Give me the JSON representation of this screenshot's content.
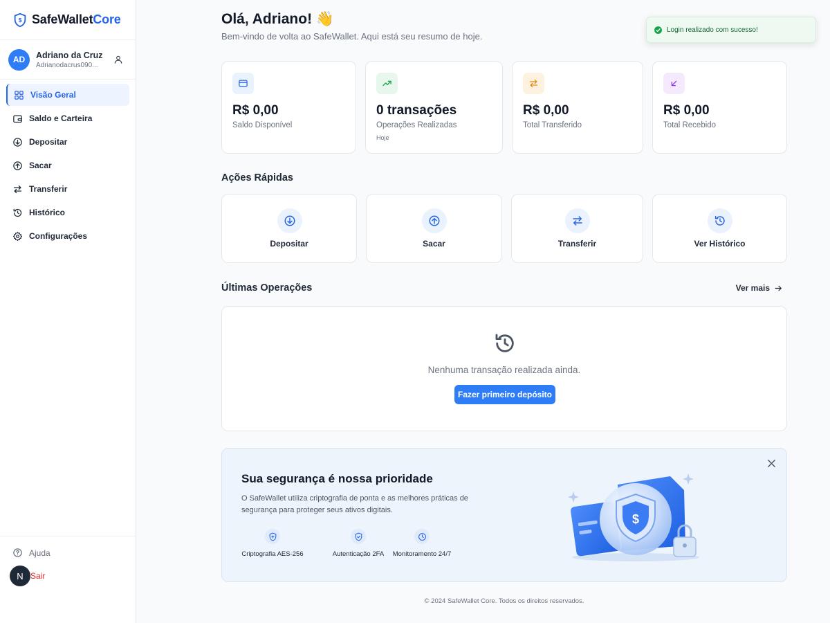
{
  "brand": {
    "name_part1": "SafeWallet",
    "name_part2": "Core"
  },
  "user": {
    "initials": "AD",
    "name": "Adriano da Cruz",
    "email": "Adrianodacrus090..."
  },
  "sidebar": {
    "items": [
      {
        "label": "Visão Geral",
        "icon": "grid-icon",
        "active": true
      },
      {
        "label": "Saldo e Carteira",
        "icon": "wallet-icon"
      },
      {
        "label": "Depositar",
        "icon": "arrow-down-circle-icon"
      },
      {
        "label": "Sacar",
        "icon": "arrow-up-circle-icon"
      },
      {
        "label": "Transferir",
        "icon": "transfer-icon"
      },
      {
        "label": "Histórico",
        "icon": "history-icon"
      },
      {
        "label": "Configurações",
        "icon": "gear-icon"
      }
    ],
    "help_label": "Ajuda",
    "logout_label": "Sair",
    "logout_avatar": "N"
  },
  "header": {
    "greeting": "Olá, Adriano! 👋",
    "subtitle": "Bem-vindo de volta ao SafeWallet. Aqui está seu resumo de hoje."
  },
  "stats": [
    {
      "value": "R$ 0,00",
      "label": "Saldo Disponível",
      "icon": "card-icon",
      "color": "#2563eb",
      "bg": "#eaf2fe"
    },
    {
      "value": "0 transações",
      "label": "Operações Realizadas",
      "extra": "Hoje",
      "icon": "trending-up-icon",
      "color": "#16a34a",
      "bg": "#e8f7ee"
    },
    {
      "value": "R$ 0,00",
      "label": "Total Transferido",
      "icon": "transfer-icon",
      "color": "#ea8a0c",
      "bg": "#fdf1e0"
    },
    {
      "value": "R$ 0,00",
      "label": "Total Recebido",
      "icon": "arrow-down-left-icon",
      "color": "#9333ea",
      "bg": "#f5eafd"
    }
  ],
  "quick_actions": {
    "title": "Ações Rápidas",
    "items": [
      {
        "label": "Depositar",
        "icon": "arrow-down-circle-icon"
      },
      {
        "label": "Sacar",
        "icon": "arrow-up-circle-icon"
      },
      {
        "label": "Transferir",
        "icon": "transfer-icon"
      },
      {
        "label": "Ver Histórico",
        "icon": "history-icon"
      }
    ]
  },
  "recent": {
    "title": "Últimas Operações",
    "see_more": "Ver mais",
    "empty_text": "Nenhuma transação realizada ainda.",
    "cta": "Fazer primeiro depósito"
  },
  "security": {
    "title": "Sua segurança é nossa prioridade",
    "description": "O SafeWallet utiliza criptografia de ponta e as melhores práticas de segurança para proteger seus ativos digitais.",
    "features": [
      {
        "label": "Criptografia AES-256",
        "icon": "shield-plus-icon"
      },
      {
        "label": "Autenticação 2FA",
        "icon": "shield-check-icon"
      },
      {
        "label": "Monitoramento 24/7",
        "icon": "clock-icon"
      }
    ]
  },
  "footer": {
    "text": "© 2024 SafeWallet Core. Todos os direitos reservados."
  },
  "toast": {
    "text": "Login realizado com sucesso!"
  },
  "colors": {
    "accent": "#2563eb",
    "success": "#16a34a",
    "danger": "#dc2626"
  }
}
